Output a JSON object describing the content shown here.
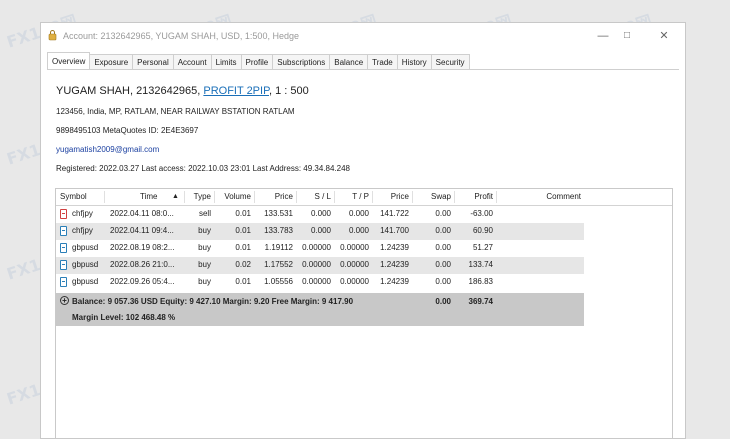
{
  "window": {
    "title": "Account: 2132642965, YUGAM SHAH, USD, 1:500, Hedge",
    "controls": [
      "—",
      "□",
      "✕"
    ]
  },
  "tabs": [
    "Overview",
    "Exposure",
    "Personal",
    "Account",
    "Limits",
    "Profile",
    "Subscriptions",
    "Balance",
    "Trade",
    "History",
    "Security"
  ],
  "active_tab": "Overview",
  "account": {
    "name_prefix": "YUGAM SHAH, 2132642965,",
    "group_link": "PROFIT 2PIP",
    "leverage": ", 1 : 500",
    "address": "123456, India, MP, RATLAM, NEAR RAILWAY BSTATION RATLAM",
    "phone_metaquotes": "9898495103  MetaQuotes ID: 2E4E3697",
    "email": "yugamatish2009@gmail.com",
    "registration": "Registered: 2022.03.27  Last access: 2022.10.03 23:01  Last Address: 49.34.84.248"
  },
  "table": {
    "columns": [
      "Symbol",
      "Time",
      "Type",
      "Volume",
      "Price",
      "S / L",
      "T / P",
      "Price",
      "Swap",
      "Profit",
      "Comment"
    ],
    "sort_indicator": "▲",
    "rows": [
      {
        "symbol": "chfjpy",
        "time": "2022.04.11 08:0...",
        "type": "sell",
        "volume": "0.01",
        "price": "133.531",
        "sl": "0.000",
        "tp": "0.000",
        "cur_price": "141.722",
        "swap": "0.00",
        "profit": "-63.00",
        "comment": "",
        "icon_color": "#d04040"
      },
      {
        "symbol": "chfjpy",
        "time": "2022.04.11 09:4...",
        "type": "buy",
        "volume": "0.01",
        "price": "133.783",
        "sl": "0.000",
        "tp": "0.000",
        "cur_price": "141.700",
        "swap": "0.00",
        "profit": "60.90",
        "comment": "",
        "icon_color": "#2a7fb8"
      },
      {
        "symbol": "gbpusd",
        "time": "2022.08.19 08:2...",
        "type": "buy",
        "volume": "0.01",
        "price": "1.19112",
        "sl": "0.00000",
        "tp": "0.00000",
        "cur_price": "1.24239",
        "swap": "0.00",
        "profit": "51.27",
        "comment": "",
        "icon_color": "#2a7fb8"
      },
      {
        "symbol": "gbpusd",
        "time": "2022.08.26 21:0...",
        "type": "buy",
        "volume": "0.02",
        "price": "1.17552",
        "sl": "0.00000",
        "tp": "0.00000",
        "cur_price": "1.24239",
        "swap": "0.00",
        "profit": "133.74",
        "comment": "",
        "icon_color": "#2a7fb8"
      },
      {
        "symbol": "gbpusd",
        "time": "2022.09.26 05:4...",
        "type": "buy",
        "volume": "0.01",
        "price": "1.05556",
        "sl": "0.00000",
        "tp": "0.00000",
        "cur_price": "1.24239",
        "swap": "0.00",
        "profit": "186.83",
        "comment": "",
        "icon_color": "#2a7fb8"
      }
    ],
    "summary": {
      "line1": "Balance: 9 057.36 USD  Equity: 9 427.10  Margin: 9.20  Free Margin: 9 417.90",
      "swap": "0.00",
      "profit": "369.74",
      "line2": "Margin Level: 102 468.48 %"
    }
  },
  "watermark": "FX110网"
}
